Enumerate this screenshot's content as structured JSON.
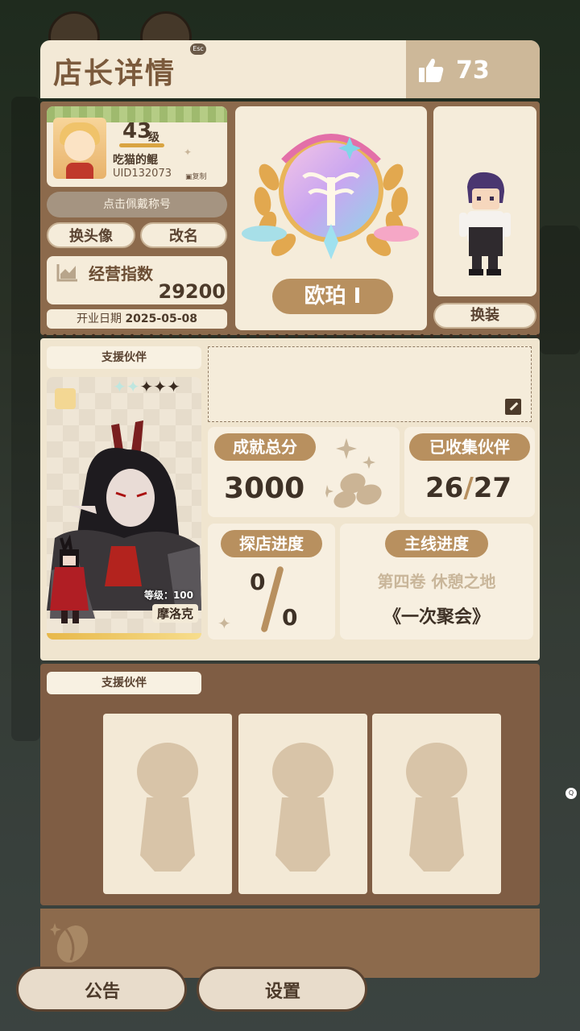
{
  "header": {
    "title": "店长详情",
    "esc_hint": "Esc",
    "like_count": "73"
  },
  "profile": {
    "level": "43",
    "level_unit": "级",
    "nickname": "吃猫的鲲",
    "uid": "UID132073",
    "copy_label": "复制",
    "title_button": "点击佩戴称号",
    "change_avatar": "换头像",
    "rename": "改名",
    "stat_label": "经营指数",
    "stat_value": "29200",
    "open_date_label": "开业日期",
    "open_date": "2025-05-08"
  },
  "rank": {
    "label": "欧珀 I"
  },
  "outfit": {
    "button": "换装"
  },
  "partner": {
    "section_label": "支援伙伴",
    "level_text": "等级：100",
    "name": "摩洛克",
    "stars_total": 5,
    "stars_light": 2
  },
  "achievements": {
    "score_label": "成就总分",
    "score_value": "3000",
    "collected_label": "已收集伙伴",
    "collected_value": "26",
    "collected_total": "27",
    "explore_label": "探店进度",
    "explore_value": "0",
    "explore_total": "0",
    "main_label": "主线进度",
    "main_chapter": "第四卷 休憩之地",
    "main_episode": "《一次聚会》"
  },
  "support": {
    "section_label": "支援伙伴"
  },
  "bottom_nav": {
    "notice": "公告",
    "settings": "设置"
  },
  "colors": {
    "accent": "#b8905f",
    "panel": "#f3e9d6",
    "frame": "#8c6a4c"
  }
}
